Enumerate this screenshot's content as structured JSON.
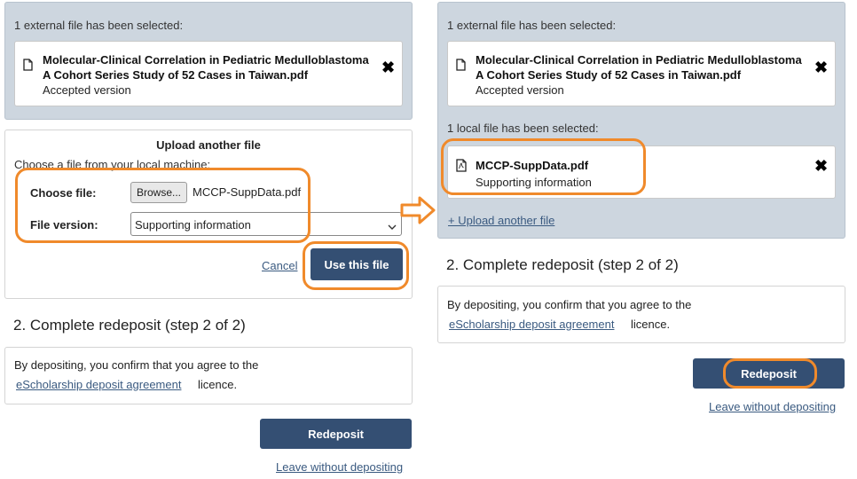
{
  "colors": {
    "accent_outline": "#f08a2b",
    "primary_button": "#344f73",
    "grey_panel": "#cdd6df",
    "link": "#3a5a80"
  },
  "left": {
    "external_header": "1 external file has been selected:",
    "external_file": {
      "line1": "Molecular-Clinical Correlation in Pediatric Medulloblastoma",
      "line2": "A Cohort Series Study of 52 Cases in Taiwan.pdf",
      "version": "Accepted version",
      "icon": "document-icon",
      "remove_icon": "close-icon"
    },
    "upload": {
      "title": "Upload another file",
      "choose_prompt": "Choose a file from your local machine:",
      "choose_label": "Choose file:",
      "browse_label": "Browse...",
      "chosen_filename": "MCCP-SuppData.pdf",
      "version_label": "File version:",
      "version_value": "Supporting information",
      "cancel_label": "Cancel",
      "use_label": "Use this file"
    },
    "step_title": "2. Complete redeposit (step 2 of 2)",
    "agreement_text": "By depositing, you confirm that you agree to the",
    "agreement_link": "eScholarship deposit agreement",
    "agreement_suffix": "licence.",
    "redeposit_label": "Redeposit",
    "leave_label": "Leave without depositing"
  },
  "right": {
    "external_header": "1 external file has been selected:",
    "external_file": {
      "line1": "Molecular-Clinical Correlation in Pediatric Medulloblastoma",
      "line2": "A Cohort Series Study of 52 Cases in Taiwan.pdf",
      "version": "Accepted version",
      "icon": "document-icon",
      "remove_icon": "close-icon"
    },
    "local_header": "1 local file has been selected:",
    "local_file": {
      "name": "MCCP-SuppData.pdf",
      "version": "Supporting information",
      "icon": "pdf-icon",
      "remove_icon": "close-icon"
    },
    "upload_another": "+ Upload another file",
    "step_title": "2. Complete redeposit (step 2 of 2)",
    "agreement_text": "By depositing, you confirm that you agree to the",
    "agreement_link": "eScholarship deposit agreement",
    "agreement_suffix": "licence.",
    "redeposit_label": "Redeposit",
    "leave_label": "Leave without depositing"
  },
  "arrow_icon": "right-arrow-icon"
}
